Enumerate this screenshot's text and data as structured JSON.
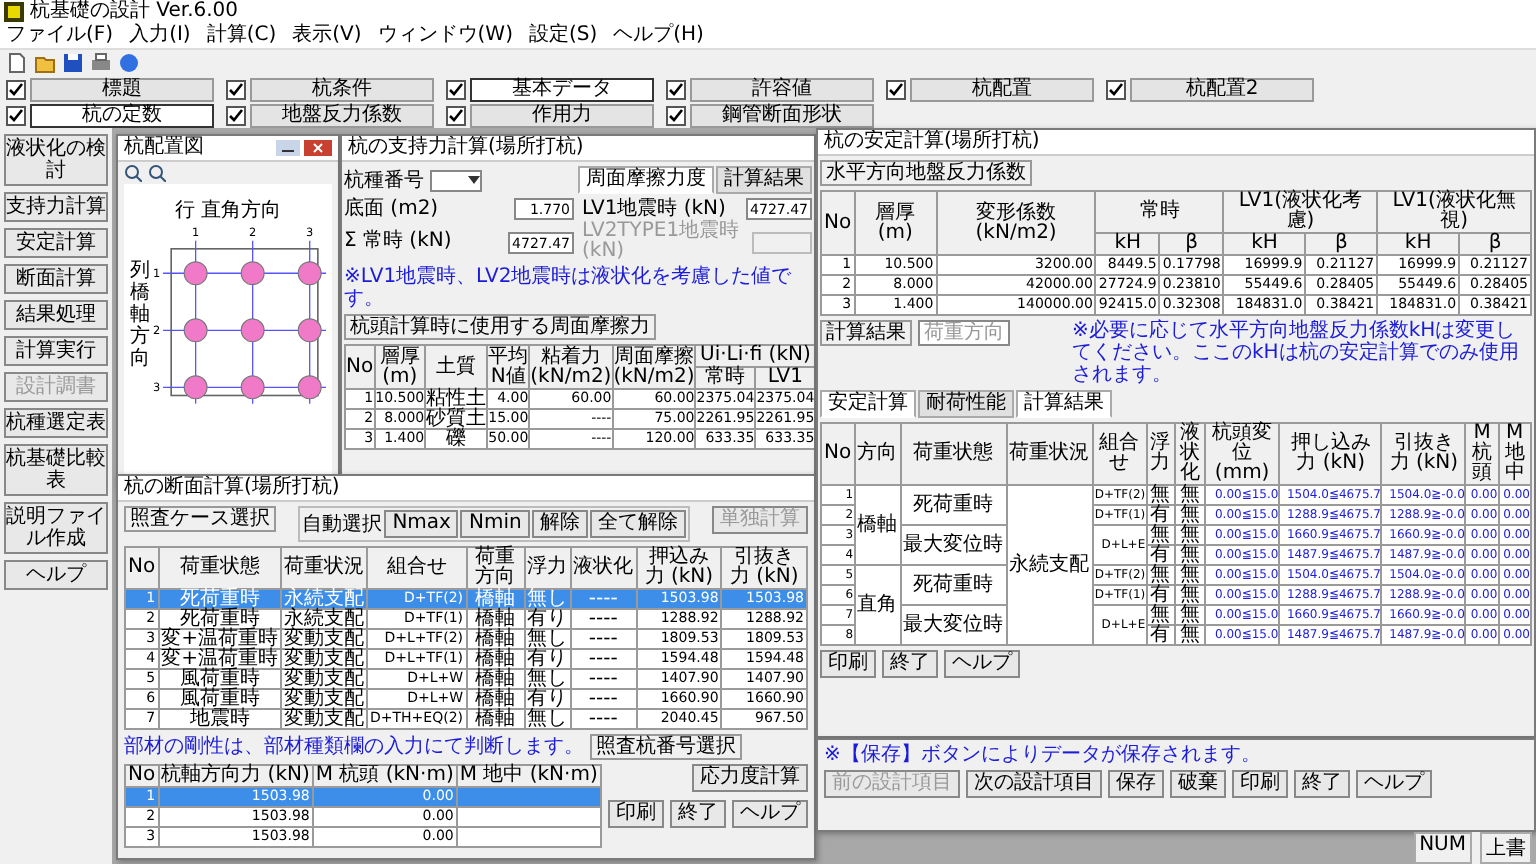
{
  "app_title": "杭基礎の設計 Ver.6.00",
  "menu": [
    "ファイル(F)",
    "入力(I)",
    "計算(C)",
    "表示(V)",
    "ウィンドウ(W)",
    "設定(S)",
    "ヘルプ(H)"
  ],
  "input_rows": [
    [
      {
        "label": "標題",
        "checked": true,
        "selected": false
      },
      {
        "label": "杭条件",
        "checked": true,
        "selected": false
      },
      {
        "label": "基本データ",
        "checked": true,
        "selected": true
      },
      {
        "label": "許容値",
        "checked": true,
        "selected": false
      },
      {
        "label": "杭配置",
        "checked": true,
        "selected": false
      },
      {
        "label": "杭配置2",
        "checked": true,
        "selected": false
      }
    ],
    [
      {
        "label": "杭の定数",
        "checked": true,
        "selected": true
      },
      {
        "label": "地盤反力係数",
        "checked": true,
        "selected": false
      },
      {
        "label": "作用力",
        "checked": true,
        "selected": false
      },
      {
        "label": "鋼管断面形状",
        "checked": true,
        "selected": false
      }
    ]
  ],
  "side_buttons": [
    {
      "label": "液状化の検討",
      "disabled": false
    },
    {
      "label": "支持力計算",
      "disabled": false
    },
    {
      "label": "安定計算",
      "disabled": false
    },
    {
      "label": "断面計算",
      "disabled": false
    },
    {
      "label": "結果処理",
      "disabled": false
    },
    {
      "label": "計算実行",
      "disabled": false
    },
    {
      "label": "設計調書",
      "disabled": true
    },
    {
      "label": "杭種選定表",
      "disabled": false
    },
    {
      "label": "杭基礎比較表",
      "disabled": false
    },
    {
      "label": "説明ファイル作成",
      "disabled": false
    },
    {
      "label": "ヘルプ",
      "disabled": false
    }
  ],
  "layout_window": {
    "title": "杭配置図",
    "row_axis": "行 直角方向",
    "col_axis": "列橋軸方向",
    "columns": [
      "1",
      "2",
      "3"
    ],
    "rows": [
      "1",
      "2",
      "3"
    ]
  },
  "capacity_window": {
    "title": "杭の支持力計算(場所打杭)",
    "pile_no_label": "杭種番号",
    "tabs": [
      {
        "label": "周面摩擦力度",
        "selected": true
      },
      {
        "label": "計算結果",
        "selected": false
      }
    ],
    "fields": [
      {
        "label": "底面 (m2)",
        "value": "1.770",
        "disabled": false
      },
      {
        "label": "Σ 常時 (kN)",
        "value": "4727.47",
        "disabled": false
      },
      {
        "label": "LV1地震時 (kN)",
        "value": "4727.47",
        "disabled": false
      },
      {
        "label": "LV2TYPE1地震時 (kN)",
        "disabled": true
      }
    ],
    "note": "※LV1地震時、LV2地震時は液状化を考慮した値です。",
    "group": "杭頭計算時に使用する周面摩擦力",
    "columns": [
      "No",
      "層厚 (m)",
      "土質",
      "平均 N値",
      "粘着力 (kN/m2)",
      "周面摩擦 (kN/m2)"
    ],
    "sum_group": "Ui·Li·fi (kN)",
    "sum_columns": [
      "常時",
      "LV1"
    ],
    "rows": [
      [
        "1",
        "10.500",
        "粘性土",
        "4.00",
        "60.00",
        "60.00",
        "2375.04",
        "2375.04"
      ],
      [
        "2",
        "8.000",
        "砂質土",
        "15.00",
        "----",
        "75.00",
        "2261.95",
        "2261.95"
      ],
      [
        "3",
        "1.400",
        "礫",
        "50.00",
        "----",
        "120.00",
        "633.35",
        "633.35"
      ]
    ]
  },
  "member_window": {
    "title": "杭の断面計算(場所打杭)",
    "case_group": "照査ケース選択",
    "auto_label": "自動選択",
    "auto_buttons": [
      "Nmax",
      "Nmin",
      "解除",
      "全て解除"
    ],
    "single_button": {
      "label": "単独計算",
      "disabled": true
    },
    "columns": [
      "No",
      "荷重状態",
      "荷重状況",
      "組合せ",
      "荷重方向",
      "浮力",
      "液状化",
      "押込み力 (kN)",
      "引抜き力 (kN)"
    ],
    "rows": [
      {
        "cells": [
          "1",
          "死荷重時",
          "永続支配",
          "D+TF(2)",
          "橋軸",
          "無し",
          "----",
          "1503.98",
          "1503.98"
        ],
        "selected": true
      },
      {
        "cells": [
          "2",
          "死荷重時",
          "永続支配",
          "D+TF(1)",
          "橋軸",
          "有り",
          "----",
          "1288.92",
          "1288.92"
        ],
        "selected": false
      },
      {
        "cells": [
          "3",
          "変+温荷重時",
          "変動支配",
          "D+L+TF(2)",
          "橋軸",
          "無し",
          "----",
          "1809.53",
          "1809.53"
        ],
        "selected": false
      },
      {
        "cells": [
          "4",
          "変+温荷重時",
          "変動支配",
          "D+L+TF(1)",
          "橋軸",
          "有り",
          "----",
          "1594.48",
          "1594.48"
        ],
        "selected": false
      },
      {
        "cells": [
          "5",
          "風荷重時",
          "変動支配",
          "D+L+W",
          "橋軸",
          "無し",
          "----",
          "1407.90",
          "1407.90"
        ],
        "selected": false
      },
      {
        "cells": [
          "6",
          "風荷重時",
          "変動支配",
          "D+L+W",
          "橋軸",
          "有り",
          "----",
          "1660.90",
          "1660.90"
        ],
        "selected": false
      },
      {
        "cells": [
          "7",
          "地震時",
          "変動支配",
          "D+TH+EQ(2)",
          "橋軸",
          "無し",
          "----",
          "2040.45",
          "967.50"
        ],
        "selected": false
      }
    ],
    "note": "部材の剛性は、部材種類欄の入力にて判断します。",
    "pile_group": "照査杭番号選択",
    "pile_columns": [
      "No",
      "杭軸方向力 (kN)",
      "M 杭頭 (kN·m)",
      "M 地中 (kN·m)"
    ],
    "pile_rows": [
      {
        "cells": [
          "1",
          "1503.98",
          "0.00"
        ],
        "selected": true
      },
      {
        "cells": [
          "2",
          "1503.98",
          "0.00"
        ],
        "selected": false
      },
      {
        "cells": [
          "3",
          "1503.98",
          "0.00"
        ],
        "selected": false
      }
    ],
    "stress_button": "応力度計算",
    "buttons": [
      "印刷",
      "終了",
      "ヘルプ"
    ]
  },
  "stability_window": {
    "title": "杭の安定計算(場所打杭)",
    "group": "水平方向地盤反力係数",
    "kh_columns": [
      "No",
      "層厚 (m)",
      "変形係数 (kN/m2)"
    ],
    "kh_groups": [
      {
        "label": "常時",
        "columns": [
          "kH",
          "β"
        ]
      },
      {
        "label": "LV1(液状化考慮)",
        "columns": [
          "kH",
          "β"
        ]
      },
      {
        "label": "LV1(液状化無視)",
        "columns": [
          "kH",
          "β"
        ]
      }
    ],
    "kh_rows": [
      [
        "1",
        "10.500",
        "3200.00",
        "8449.5",
        "0.17798",
        "16999.9",
        "0.21127",
        "16999.9",
        "0.21127"
      ],
      [
        "2",
        "8.000",
        "42000.00",
        "27724.9",
        "0.23810",
        "55449.6",
        "0.28405",
        "55449.6",
        "0.28405"
      ],
      [
        "3",
        "1.400",
        "140000.00",
        "92415.0",
        "0.32308",
        "184831.0",
        "0.38421",
        "184831.0",
        "0.38421"
      ]
    ],
    "result_label": "計算結果",
    "select_value": "荷重方向",
    "note": "※必要に応じて水平方向地盤反力係数kHは変更してください。ここのkHは杭の安定計算でのみ使用されます。",
    "tabs": [
      {
        "label": "安定計算",
        "selected": true
      },
      {
        "label": "耐荷性能",
        "selected": false
      }
    ],
    "subtab": "計算結果",
    "result_columns": [
      "No",
      "方向",
      "荷重状態",
      "荷重状況",
      "組合せ",
      "浮力",
      "液状化",
      "杭頭変位 (mm)",
      "押し込み力 (kN)",
      "引抜き力 (kN)",
      "M杭頭",
      "M地中"
    ],
    "result_rows": [
      {
        "no": "1",
        "direction": "橋軸",
        "state": "死荷重時",
        "situation": "永続支配",
        "combo": "D+TF(2)",
        "buoyancy": "無",
        "liquefaction": "無",
        "disp": "0.00≦15.0",
        "push": "1504.0≦4675.7",
        "pull": "1504.0≧-0.0",
        "m_head": "0.00",
        "m_ground": "0.00"
      },
      {
        "no": "2",
        "combo": "D+TF(1)",
        "buoyancy": "有",
        "liquefaction": "無",
        "disp": "0.00≦15.0",
        "push": "1288.9≦4675.7",
        "pull": "1288.9≧-0.0",
        "m_head": "0.00",
        "m_ground": "0.00"
      },
      {
        "no": "3",
        "state": "最大変位時",
        "combo": "D+L+E",
        "buoyancy": "無",
        "liquefaction": "無",
        "disp": "0.00≦15.0",
        "push": "1660.9≦4675.7",
        "pull": "1660.9≧-0.0",
        "m_head": "0.00",
        "m_ground": "0.00"
      },
      {
        "no": "4",
        "buoyancy": "有",
        "liquefaction": "無",
        "disp": "0.00≦15.0",
        "push": "1487.9≦4675.7",
        "pull": "1487.9≧-0.0",
        "m_head": "0.00",
        "m_ground": "0.00"
      },
      {
        "no": "5",
        "direction": "直角",
        "state": "死荷重時",
        "combo": "D+TF(2)",
        "buoyancy": "無",
        "liquefaction": "無",
        "disp": "0.00≦15.0",
        "push": "1504.0≦4675.7",
        "pull": "1504.0≧-0.0",
        "m_head": "0.00",
        "m_ground": "0.00"
      },
      {
        "no": "6",
        "combo": "D+TF(1)",
        "buoyancy": "有",
        "liquefaction": "無",
        "disp": "0.00≦15.0",
        "push": "1288.9≦4675.7",
        "pull": "1288.9≧-0.0",
        "m_head": "0.00",
        "m_ground": "0.00"
      },
      {
        "no": "7",
        "state": "最大変位時",
        "combo": "D+L+E",
        "buoyancy": "無",
        "liquefaction": "無",
        "disp": "0.00≦15.0",
        "push": "1660.9≦4675.7",
        "pull": "1660.9≧-0.0",
        "m_head": "0.00",
        "m_ground": "0.00"
      },
      {
        "no": "8",
        "buoyancy": "有",
        "liquefaction": "無",
        "disp": "0.00≦15.0",
        "push": "1487.9≦4675.7",
        "pull": "1487.9≧-0.0",
        "m_head": "0.00",
        "m_ground": "0.00"
      }
    ],
    "buttons": [
      "印刷",
      "終了",
      "ヘルプ"
    ]
  },
  "base_window": {
    "note": "※【保存】ボタンによりデータが保存されます。",
    "buttons": [
      {
        "label": "前の設計項目",
        "disabled": true
      },
      {
        "label": "次の設計項目",
        "disabled": false
      },
      {
        "label": "保存",
        "disabled": false
      },
      {
        "label": "破棄",
        "disabled": false
      },
      {
        "label": "印刷",
        "disabled": false
      },
      {
        "label": "終了",
        "disabled": false
      },
      {
        "label": "ヘルプ",
        "disabled": false
      }
    ]
  },
  "status_bar": [
    "NUM",
    "上書"
  ]
}
